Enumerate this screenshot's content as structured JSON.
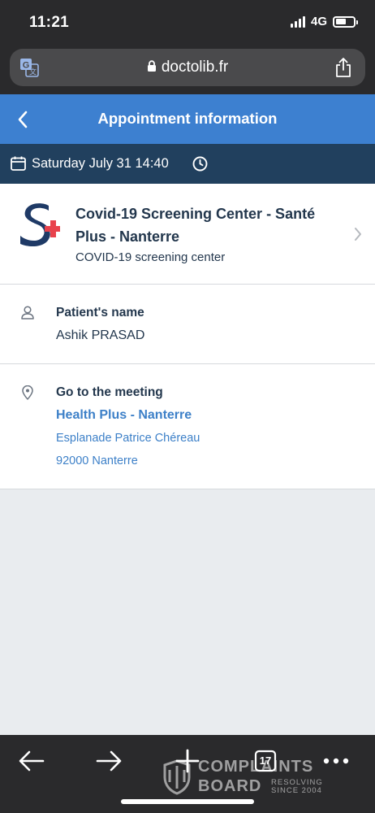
{
  "status_bar": {
    "time": "11:21",
    "network": "4G",
    "signal_bars": 4,
    "battery_level": 0.6
  },
  "browser": {
    "url": "doctolib.fr",
    "icons": {
      "translate": "translate-icon",
      "lock": "lock-icon",
      "share": "share-icon"
    },
    "toolbar": {
      "tab_count": "17",
      "icons": [
        "back-arrow-icon",
        "forward-arrow-icon",
        "new-tab-plus-icon",
        "tabs-icon",
        "more-dots-icon"
      ]
    }
  },
  "header": {
    "title": "Appointment information",
    "color": "#3d80d0"
  },
  "appointment": {
    "date": "Saturday July 31 14:40",
    "bar_color": "#21405e"
  },
  "practice": {
    "name": "Covid-19 Screening Center - Santé Plus - Nanterre",
    "type": "COVID-19 screening center",
    "logo_colors": [
      "#1f3a66",
      "#e8424c"
    ]
  },
  "patient": {
    "label": "Patient's name",
    "name": "Ashik PRASAD"
  },
  "location": {
    "label": "Go to the meeting",
    "name": "Health Plus - Nanterre",
    "street": "Esplanade Patrice Chéreau",
    "city": "92000 Nanterre",
    "link_color": "#3d80c8"
  },
  "watermark": {
    "line1": "COMPLAINTS",
    "line2": "BOARD",
    "tagline1": "RESOLVING",
    "tagline2": "SINCE 2004"
  }
}
